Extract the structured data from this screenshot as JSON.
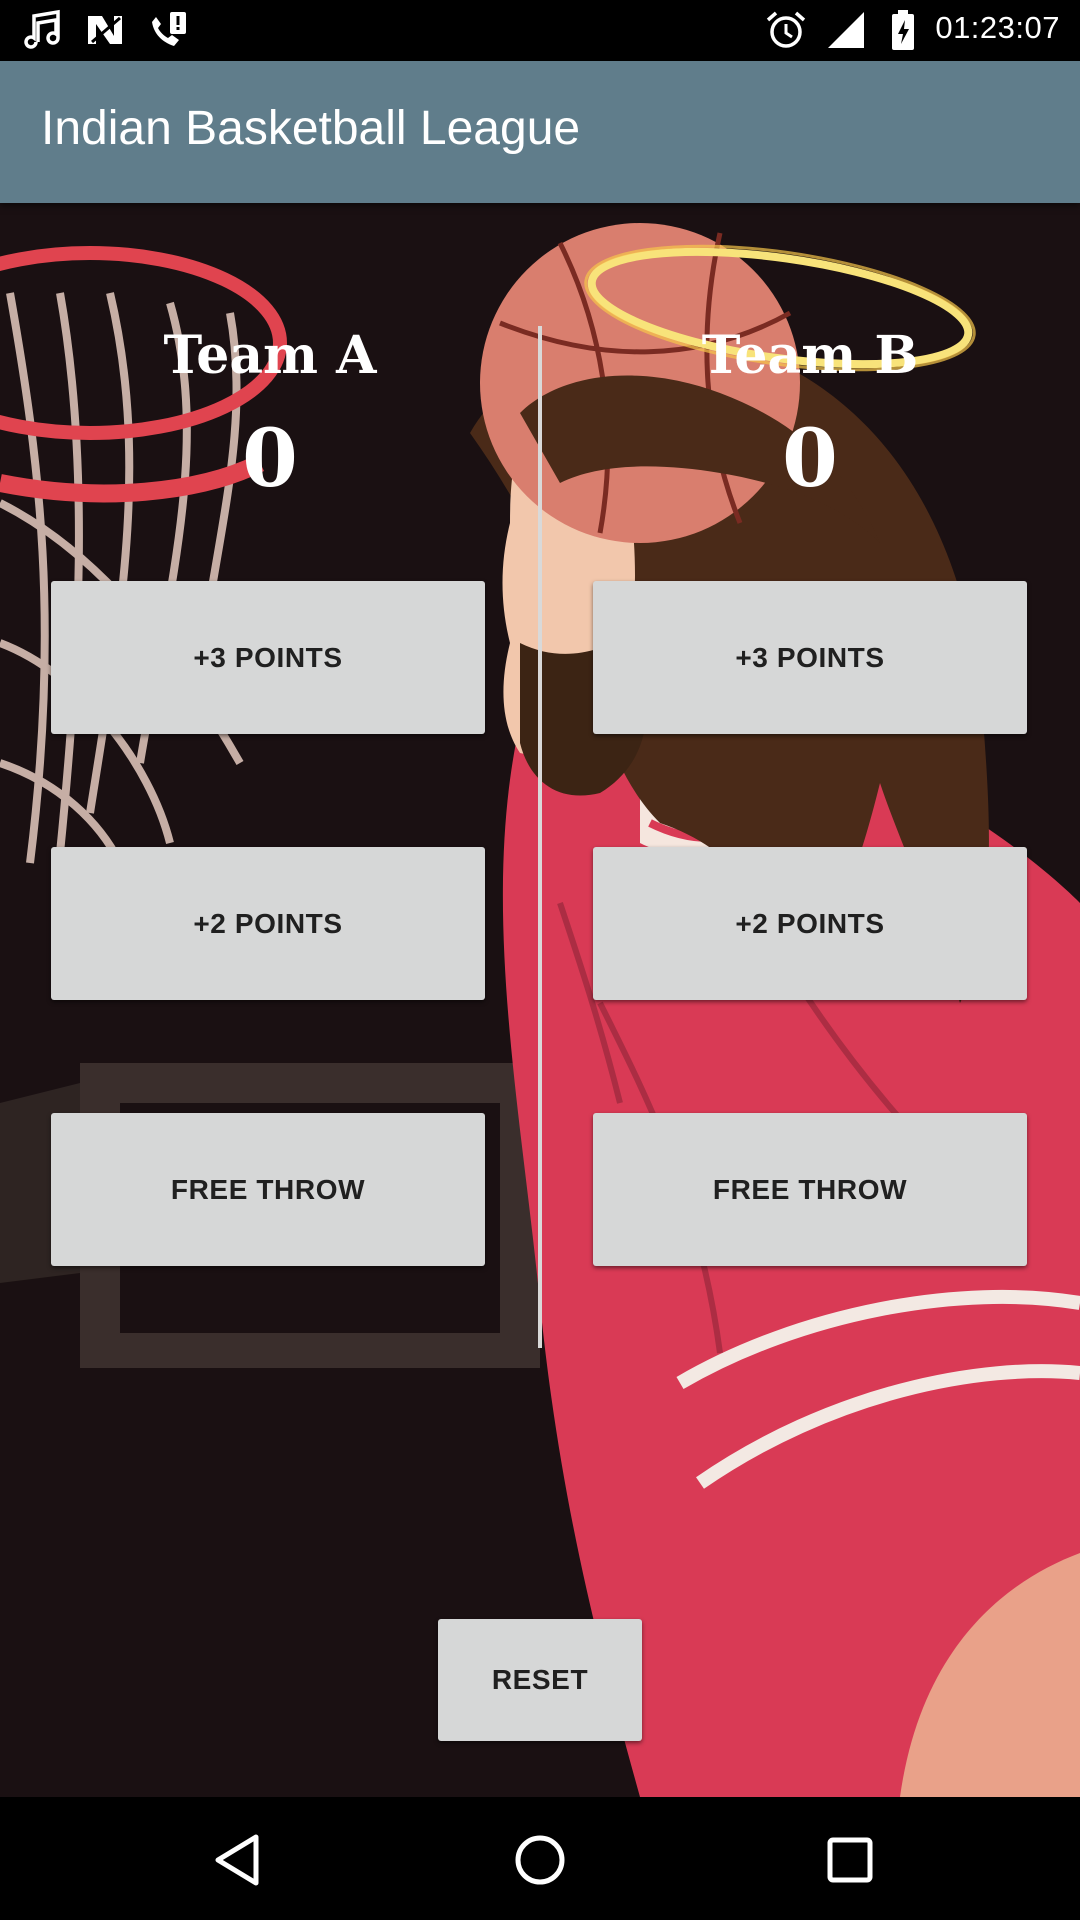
{
  "status_bar": {
    "time": "01:23:07",
    "left_icons": [
      "music-note-icon",
      "n-notification-icon",
      "phone-alert-icon"
    ],
    "right_icons": [
      "alarm-icon",
      "signal-icon",
      "battery-charging-icon"
    ]
  },
  "app_bar": {
    "title": "Indian Basketball League",
    "color": "#607d8b"
  },
  "team_a": {
    "name": "Team A",
    "score": "0",
    "buttons": {
      "three": "+3 POINTS",
      "two": "+2 POINTS",
      "free_throw": "FREE THROW"
    }
  },
  "team_b": {
    "name": "Team B",
    "score": "0",
    "buttons": {
      "three": "+3 POINTS",
      "two": "+2 POINTS",
      "free_throw": "FREE THROW"
    }
  },
  "reset_label": "RESET",
  "nav_bar": {
    "icons": [
      "back-icon",
      "home-icon",
      "recents-icon"
    ]
  },
  "colors": {
    "button_bg": "#d6d7d7",
    "jersey_red": "#d93a55"
  }
}
